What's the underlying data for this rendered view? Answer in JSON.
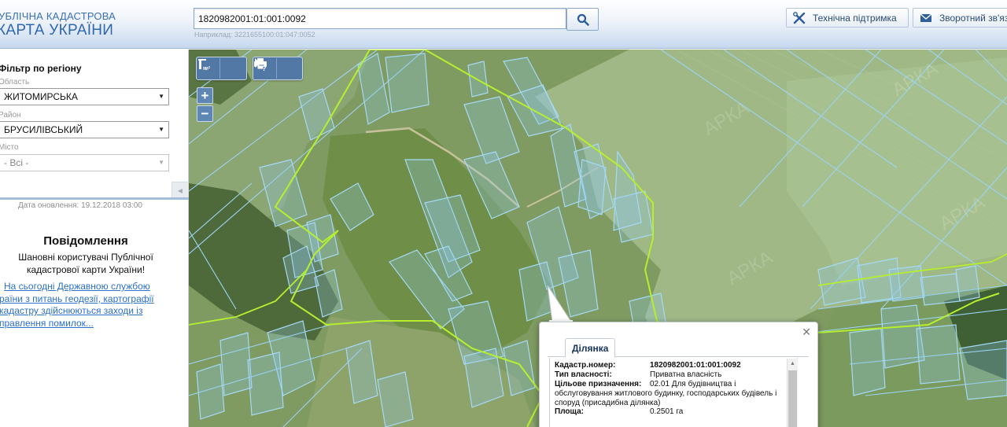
{
  "header": {
    "logo_line1": "УБЛІЧНА КАДАСТРОВА",
    "logo_line2": "КАРТА УКРАЇНИ",
    "search_value": "1820982001:01:001:0092",
    "search_example": "Наприклад: 3221655100:01:047:0052",
    "support_label": "Технічна підтримка",
    "feedback_label": "Зворотний зв'яз",
    "search_icon": "search-icon",
    "support_icon": "tools-icon",
    "feedback_icon": "envelope-icon"
  },
  "sidebar": {
    "filter_title": "Фільтр по регіону",
    "region_label": "Область",
    "region_value": "ЖИТОМИРСЬКА",
    "district_label": "Район",
    "district_value": "БРУСИЛІВСЬКИЙ",
    "city_label": "Місто",
    "city_value": "- Всі -",
    "update_date": "Дата оновлення: 19.12.2018 03:00",
    "notice_title": "Повідомлення",
    "notice_text_lines": [
      "Шановні користувачі Публічної",
      "кадастрової карти України!"
    ],
    "notice_link_lines": [
      "На сьогодні Державною службою",
      "раїни з питань геодезії, картографії",
      "кадастру здійснюються заходи із",
      "правлення помилок..."
    ]
  },
  "map": {
    "toolbar_icons": [
      "ruler-line-icon",
      "ruler-area-icon",
      "print-icon",
      "identify-icon"
    ],
    "zoom_in": "+",
    "zoom_out": "−",
    "watermark": "АРКА"
  },
  "popup": {
    "tab_label": "Ділянка",
    "fields": [
      {
        "label": "Кадастр.номер:",
        "value": "1820982001:01:001:0092"
      },
      {
        "label": "Тип власності:",
        "value": "Приватна власність"
      },
      {
        "label": "Цільове призначення:",
        "value": "02.01 Для будівництва і"
      },
      {
        "label": "",
        "value": "обслуговування житлового будинку, господарських будівель і"
      },
      {
        "label": "",
        "value": "споруд (присадибна ділянка)"
      },
      {
        "label": "Площа:",
        "value": "0.2501 га"
      }
    ]
  },
  "colors": {
    "parcel_stroke": "#9cd3f2",
    "boundary": "#b6ef2e",
    "accent": "#2f67ad"
  }
}
